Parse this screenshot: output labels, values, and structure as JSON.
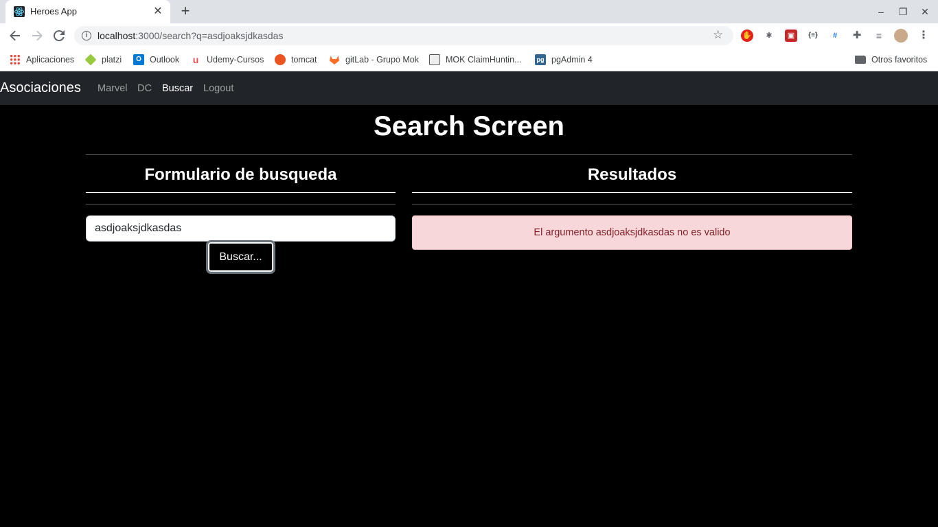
{
  "browser": {
    "tab_title": "Heroes App",
    "tab_close": "✕",
    "new_tab": "+",
    "window_controls": [
      "–",
      "❐",
      "✕"
    ],
    "url_host": "localhost",
    "url_rest": ":3000/search?q=asdjoaksjdkasdas",
    "icons": [
      "back-icon",
      "forward-icon",
      "reload-icon",
      "info-icon",
      "star-icon",
      "extension-icon",
      "profile-avatar"
    ],
    "bookmarks": [
      {
        "label": "Aplicaciones",
        "color": "#ea4335"
      },
      {
        "label": "platzi",
        "color": "#98ca3f"
      },
      {
        "label": "Outlook",
        "color": "#0078d4"
      },
      {
        "label": "Udemy-Cursos",
        "color": "#ec5252"
      },
      {
        "label": "tomcat",
        "color": "#e95420"
      },
      {
        "label": "gitLab - Grupo Mok",
        "color": "#fc6d26"
      },
      {
        "label": "MOK ClaimHuntin...",
        "color": "#777777"
      },
      {
        "label": "pgAdmin 4",
        "color": "#336791"
      }
    ],
    "other_bookmarks": "Otros favoritos"
  },
  "nav": {
    "brand": "Asociaciones",
    "links": [
      "Marvel",
      "DC",
      "Buscar",
      "Logout"
    ],
    "active": "Buscar"
  },
  "page": {
    "title": "Search Screen",
    "form_title": "Formulario de busqueda",
    "results_title": "Resultados",
    "search_value": "asdjoaksjdkasdas",
    "search_button": "Buscar...",
    "alert_text": "El argumento asdjoaksjdkasdas no es valido"
  },
  "colors": {
    "navbar": "#212529",
    "alert_bg": "#f8d7da",
    "alert_text": "#842029"
  }
}
